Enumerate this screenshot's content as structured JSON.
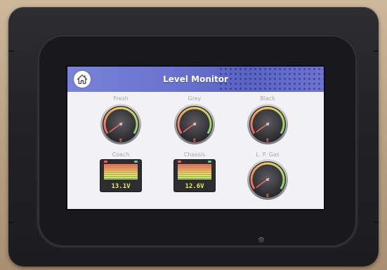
{
  "header": {
    "title": "Level Monitor",
    "home_icon": "home-icon"
  },
  "tanks": [
    {
      "label": "Fresh",
      "level_fraction": 0.0,
      "low_mark": "E"
    },
    {
      "label": "Grey",
      "level_fraction": 0.0,
      "low_mark": "E"
    },
    {
      "label": "Black",
      "level_fraction": 0.0,
      "low_mark": "E"
    }
  ],
  "batteries": [
    {
      "label": "Coach",
      "voltage": "13.1V"
    },
    {
      "label": "Chassis",
      "voltage": "12.6V"
    }
  ],
  "lp_gas": {
    "label": "L. P. Gas",
    "level_fraction": 0.0,
    "low_mark": "E"
  },
  "colors": {
    "header": "#6a73cf",
    "gauge_low": "#f0665a",
    "gauge_high": "#7fe06b",
    "voltage_text": "#e8f046",
    "screen_bg": "#f2f2f4"
  }
}
